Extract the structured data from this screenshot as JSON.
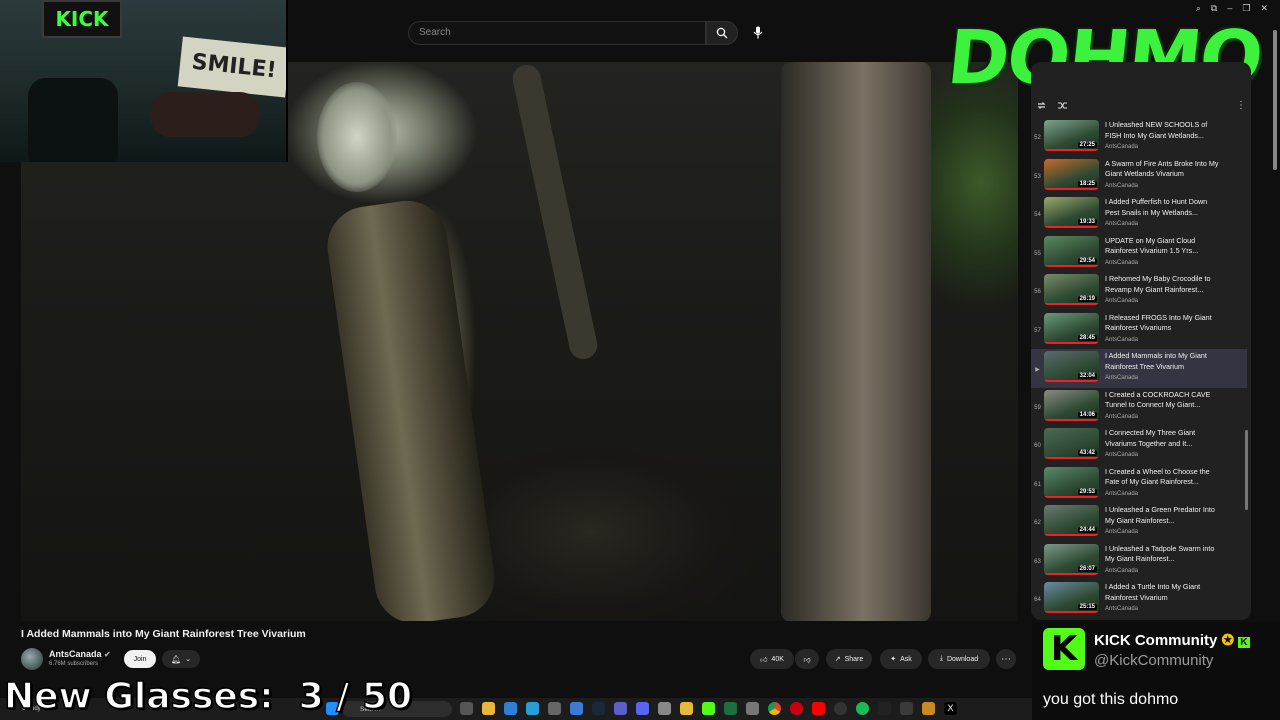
{
  "top": {
    "search_placeholder": "Search"
  },
  "video": {
    "title": "I Added Mammals into My Giant Rainforest Tree Vivarium",
    "channel": "AntsCanada",
    "subscribers": "6.76M subscribers",
    "join_label": "Join",
    "likes": "40K",
    "share_label": "Share",
    "ask_label": "Ask",
    "download_label": "Download"
  },
  "webcam": {
    "flag_text": "KICK",
    "poster_text": "SMILE!"
  },
  "overlay": {
    "logo_text": "DOHMO",
    "counter_text": "New Glasses:  3 / 50"
  },
  "playlist": {
    "items": [
      {
        "num": "52",
        "title": "I Unleashed NEW SCHOOLS of FISH Into My Giant Wetlands...",
        "channel": "AntsCanada",
        "duration": "27:25"
      },
      {
        "num": "53",
        "title": "A Swarm of Fire Ants Broke Into My Giant Wetlands Vivarium",
        "channel": "AntsCanada",
        "duration": "18:25"
      },
      {
        "num": "54",
        "title": "I Added Pufferfish to Hunt Down Pest Snails in My Wetlands...",
        "channel": "AntsCanada",
        "duration": "19:33"
      },
      {
        "num": "55",
        "title": "UPDATE on My Giant Cloud Rainforest Vivarium 1.5 Yrs...",
        "channel": "AntsCanada",
        "duration": "29:54"
      },
      {
        "num": "56",
        "title": "I Rehomed My Baby Crocodile to Revamp My Giant Rainforest...",
        "channel": "AntsCanada",
        "duration": "26:19"
      },
      {
        "num": "57",
        "title": "I Released FROGS Into My Giant Rainforest Vivariums",
        "channel": "AntsCanada",
        "duration": "28:45"
      },
      {
        "num": "▶",
        "title": "I Added Mammals into My Giant Rainforest Tree Vivarium",
        "channel": "AntsCanada",
        "duration": "32:04",
        "active": true
      },
      {
        "num": "59",
        "title": "I Created a COCKROACH CAVE Tunnel to Connect My Giant...",
        "channel": "AntsCanada",
        "duration": "14:06"
      },
      {
        "num": "60",
        "title": "I Connected My Three Giant Vivariums Together and It...",
        "channel": "AntsCanada",
        "duration": "43:42"
      },
      {
        "num": "61",
        "title": "I Created a Wheel to Choose the Fate of My Giant Rainforest...",
        "channel": "AntsCanada",
        "duration": "29:53"
      },
      {
        "num": "62",
        "title": "I Unleashed a Green Predator Into My Giant Rainforest...",
        "channel": "AntsCanada",
        "duration": "24:44"
      },
      {
        "num": "63",
        "title": "I Unleashed a Tadpole Swarm into My Giant Rainforest...",
        "channel": "AntsCanada",
        "duration": "26:07"
      },
      {
        "num": "64",
        "title": "I Added a Turtle Into My Giant Rainforest Vivarium",
        "channel": "AntsCanada",
        "duration": "25:15"
      }
    ]
  },
  "kick": {
    "community_name": "KICK Community",
    "handle": "@KickCommunity",
    "message": "you got this dohmo",
    "brand_color": "#53fc18"
  },
  "taskbar": {
    "search_label": "Search",
    "weather": "Cloudy"
  }
}
